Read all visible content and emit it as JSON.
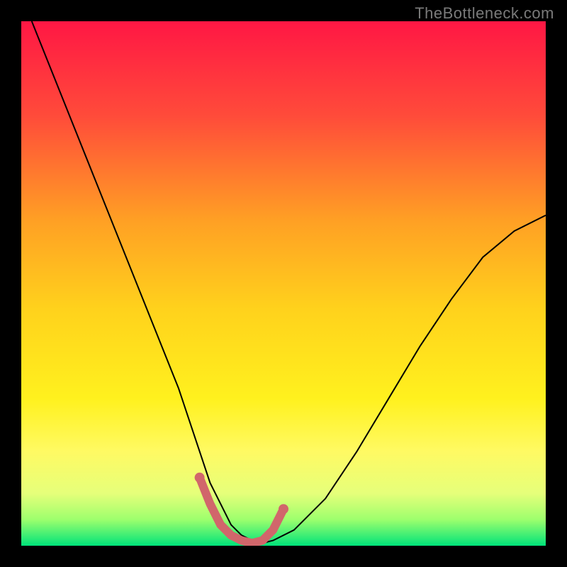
{
  "watermark": {
    "text": "TheBottleneck.com"
  },
  "chart_data": {
    "type": "line",
    "title": "",
    "xlabel": "",
    "ylabel": "",
    "xlim": [
      0,
      100
    ],
    "ylim": [
      0,
      100
    ],
    "grid": false,
    "legend": null,
    "background_gradient": {
      "stops": [
        {
          "offset": 0.0,
          "color": "#ff1744"
        },
        {
          "offset": 0.18,
          "color": "#ff4b3a"
        },
        {
          "offset": 0.38,
          "color": "#ffa024"
        },
        {
          "offset": 0.55,
          "color": "#ffd21c"
        },
        {
          "offset": 0.72,
          "color": "#fff11e"
        },
        {
          "offset": 0.82,
          "color": "#fffa63"
        },
        {
          "offset": 0.9,
          "color": "#e6ff7a"
        },
        {
          "offset": 0.95,
          "color": "#9dff6d"
        },
        {
          "offset": 1.0,
          "color": "#00e37a"
        }
      ]
    },
    "series": [
      {
        "name": "bottleneck-curve",
        "color": "#000000",
        "width": 2,
        "x": [
          2,
          6,
          10,
          14,
          18,
          22,
          26,
          30,
          32,
          34,
          36,
          38,
          40,
          42,
          44,
          46,
          48,
          52,
          58,
          64,
          70,
          76,
          82,
          88,
          94,
          100
        ],
        "y": [
          100,
          90,
          80,
          70,
          60,
          50,
          40,
          30,
          24,
          18,
          12,
          8,
          4,
          2,
          1,
          0.5,
          1,
          3,
          9,
          18,
          28,
          38,
          47,
          55,
          60,
          63
        ]
      },
      {
        "name": "highlight-band",
        "color": "#d1666b",
        "width": 12,
        "linecap": "round",
        "x": [
          34,
          36,
          38,
          40,
          42,
          44,
          46,
          48,
          50
        ],
        "y": [
          13,
          8,
          4,
          2,
          1,
          0.5,
          1,
          3,
          7
        ]
      }
    ],
    "highlight_dots": {
      "color": "#d1666b",
      "radius": 7,
      "points": [
        {
          "x": 34,
          "y": 13
        },
        {
          "x": 50,
          "y": 7
        }
      ]
    }
  }
}
